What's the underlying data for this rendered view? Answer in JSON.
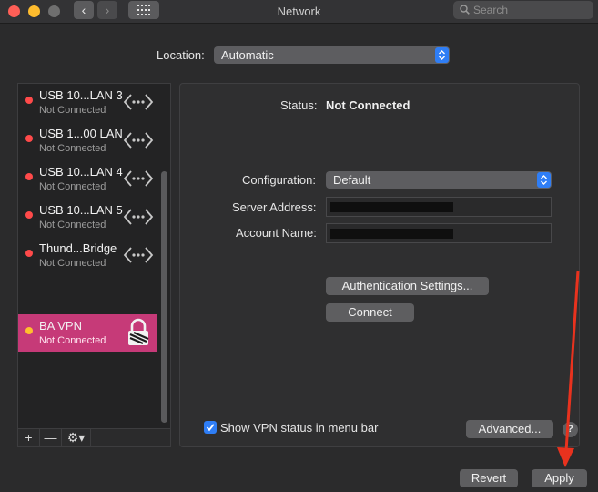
{
  "window": {
    "title": "Network"
  },
  "titlebar": {
    "back_icon": "chevron-left-icon",
    "forward_icon": "chevron-right-icon",
    "grid_icon": "grid-icon",
    "search_placeholder": "Search"
  },
  "location": {
    "label": "Location:",
    "value": "Automatic"
  },
  "services": [
    {
      "name": "USB 10...LAN 3",
      "status": "Not Connected",
      "icon": "ethernet-arrows-icon",
      "dot_color": "#ff4a4a"
    },
    {
      "name": "USB 1...00 LAN",
      "status": "Not Connected",
      "icon": "ethernet-arrows-icon",
      "dot_color": "#ff4a4a"
    },
    {
      "name": "USB 10...LAN 4",
      "status": "Not Connected",
      "icon": "ethernet-arrows-icon",
      "dot_color": "#ff4a4a"
    },
    {
      "name": "USB 10...LAN 5",
      "status": "Not Connected",
      "icon": "ethernet-arrows-icon",
      "dot_color": "#ff4a4a"
    },
    {
      "name": "Thund...Bridge",
      "status": "Not Connected",
      "icon": "ethernet-arrows-icon",
      "dot_color": "#ff4a4a"
    },
    {
      "name": "BA VPN",
      "status": "Not Connected",
      "icon": "vpn-lock-icon",
      "dot_color": "#ffbf2e",
      "selected": true
    }
  ],
  "sidebar_tools": {
    "add": "+",
    "remove": "—",
    "gear": "⚙▾"
  },
  "detail": {
    "status_label": "Status:",
    "status_value": "Not Connected",
    "configuration_label": "Configuration:",
    "configuration_value": "Default",
    "server_address_label": "Server Address:",
    "server_address_value": "",
    "account_name_label": "Account Name:",
    "account_name_value": "",
    "auth_settings_button": "Authentication Settings...",
    "connect_button": "Connect",
    "show_vpn_status_label": "Show VPN status in menu bar",
    "show_vpn_status_checked": true,
    "advanced_button": "Advanced...",
    "help_button": "?"
  },
  "footer": {
    "revert_button": "Revert",
    "apply_button": "Apply"
  },
  "colors": {
    "accent": "#2f7ef6",
    "selected_row": "#c63a78",
    "annotation_arrow": "#e8321e"
  }
}
